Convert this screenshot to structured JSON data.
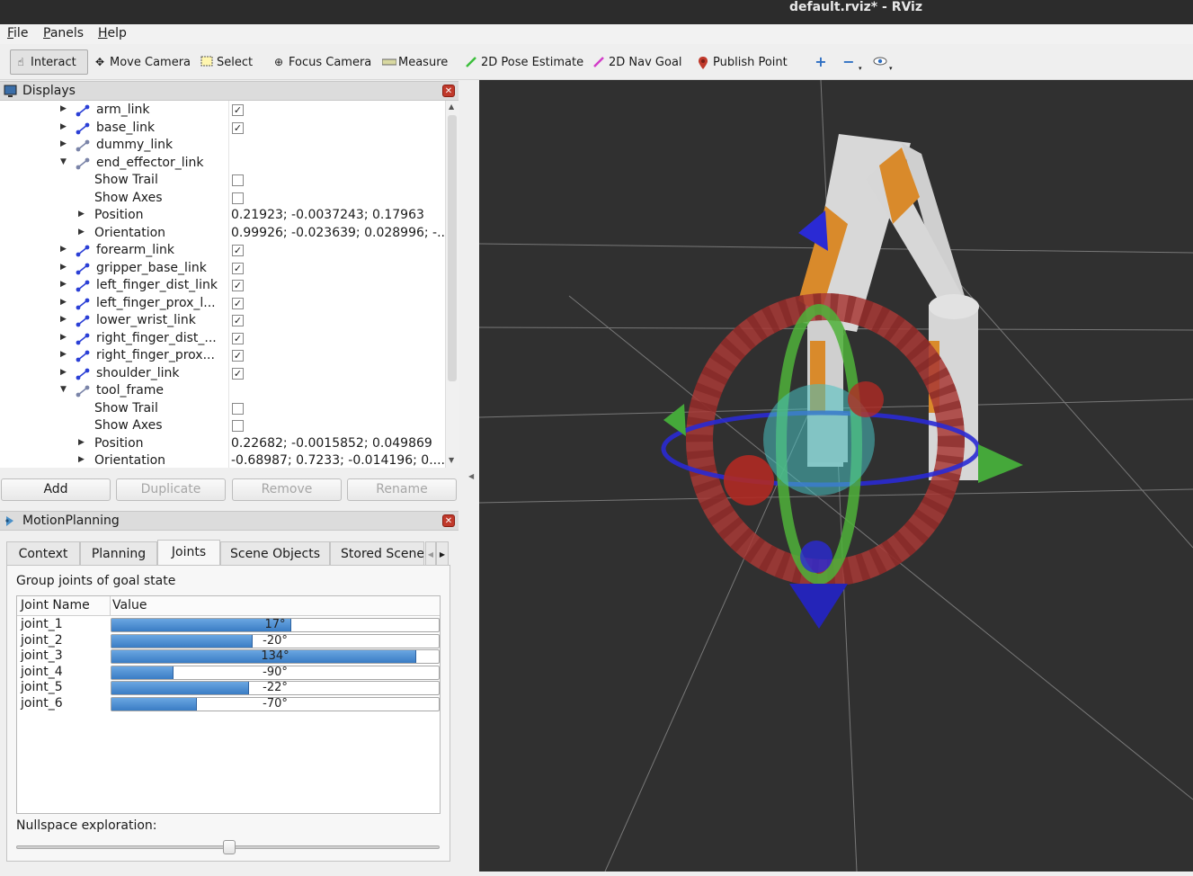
{
  "window": {
    "title": "default.rviz* - RViz"
  },
  "menu": [
    "File",
    "Panels",
    "Help"
  ],
  "toolbar": {
    "tools": [
      {
        "label": "Interact",
        "icon": "hand-icon",
        "active": true
      },
      {
        "label": "Move Camera",
        "icon": "move-camera-icon"
      },
      {
        "label": "Select",
        "icon": "select-icon"
      },
      {
        "label": "Focus Camera",
        "icon": "focus-camera-icon"
      },
      {
        "label": "Measure",
        "icon": "ruler-icon"
      },
      {
        "label": "2D Pose Estimate",
        "icon": "green-arrow-icon"
      },
      {
        "label": "2D Nav Goal",
        "icon": "magenta-arrow-icon"
      },
      {
        "label": "Publish Point",
        "icon": "map-pin-icon"
      }
    ]
  },
  "displays": {
    "title": "Displays",
    "rows": [
      {
        "name": "arm_link",
        "type": "link",
        "expanded": false,
        "checked": true
      },
      {
        "name": "base_link",
        "type": "link",
        "expanded": false,
        "checked": true
      },
      {
        "name": "dummy_link",
        "type": "link-gray",
        "expanded": false
      },
      {
        "name": "end_effector_link",
        "type": "link-gray",
        "expanded": true
      },
      {
        "name": "Show Trail",
        "type": "prop",
        "checkbox": true,
        "checked": false
      },
      {
        "name": "Show Axes",
        "type": "prop",
        "checkbox": true,
        "checked": false
      },
      {
        "name": "Position",
        "type": "prop-expand",
        "value": "0.21923; -0.0037243; 0.17963"
      },
      {
        "name": "Orientation",
        "type": "prop-expand",
        "value": "0.99926; -0.023639; 0.028996; -..."
      },
      {
        "name": "forearm_link",
        "type": "link",
        "expanded": false,
        "checked": true
      },
      {
        "name": "gripper_base_link",
        "type": "link",
        "expanded": false,
        "checked": true
      },
      {
        "name": "left_finger_dist_link",
        "type": "link",
        "expanded": false,
        "checked": true
      },
      {
        "name": "left_finger_prox_l...",
        "type": "link",
        "expanded": false,
        "checked": true
      },
      {
        "name": "lower_wrist_link",
        "type": "link",
        "expanded": false,
        "checked": true
      },
      {
        "name": "right_finger_dist_...",
        "type": "link",
        "expanded": false,
        "checked": true
      },
      {
        "name": "right_finger_prox...",
        "type": "link",
        "expanded": false,
        "checked": true
      },
      {
        "name": "shoulder_link",
        "type": "link",
        "expanded": false,
        "checked": true
      },
      {
        "name": "tool_frame",
        "type": "link-gray",
        "expanded": true
      },
      {
        "name": "Show Trail",
        "type": "prop",
        "checkbox": true,
        "checked": false
      },
      {
        "name": "Show Axes",
        "type": "prop",
        "checkbox": true,
        "checked": false
      },
      {
        "name": "Position",
        "type": "prop-expand",
        "value": "0.22682; -0.0015852; 0.049869"
      },
      {
        "name": "Orientation",
        "type": "prop-expand",
        "value": "-0.68987; 0.7233; -0.014196; 0...."
      }
    ],
    "buttons": [
      {
        "label": "Add",
        "enabled": true
      },
      {
        "label": "Duplicate",
        "enabled": false
      },
      {
        "label": "Remove",
        "enabled": false
      },
      {
        "label": "Rename",
        "enabled": false
      }
    ]
  },
  "motion_planning": {
    "title": "MotionPlanning",
    "tabs": [
      "Context",
      "Planning",
      "Joints",
      "Scene Objects",
      "Stored Scene"
    ],
    "active_tab": "Joints",
    "group_label": "Group joints of goal state",
    "columns": [
      "Joint Name",
      "Value"
    ],
    "joints": [
      {
        "name": "joint_1",
        "value": "17°",
        "fraction": 0.55
      },
      {
        "name": "joint_2",
        "value": "-20°",
        "fraction": 0.43
      },
      {
        "name": "joint_3",
        "value": "134°",
        "fraction": 0.93
      },
      {
        "name": "joint_4",
        "value": "-90°",
        "fraction": 0.19
      },
      {
        "name": "joint_5",
        "value": "-22°",
        "fraction": 0.42
      },
      {
        "name": "joint_6",
        "value": "-70°",
        "fraction": 0.26
      }
    ],
    "nullspace_label": "Nullspace exploration:",
    "nullspace_fraction": 0.5
  },
  "colors": {
    "accent": "#3a7cc4",
    "viewport_bg": "#303030",
    "close": "#c0392b"
  }
}
